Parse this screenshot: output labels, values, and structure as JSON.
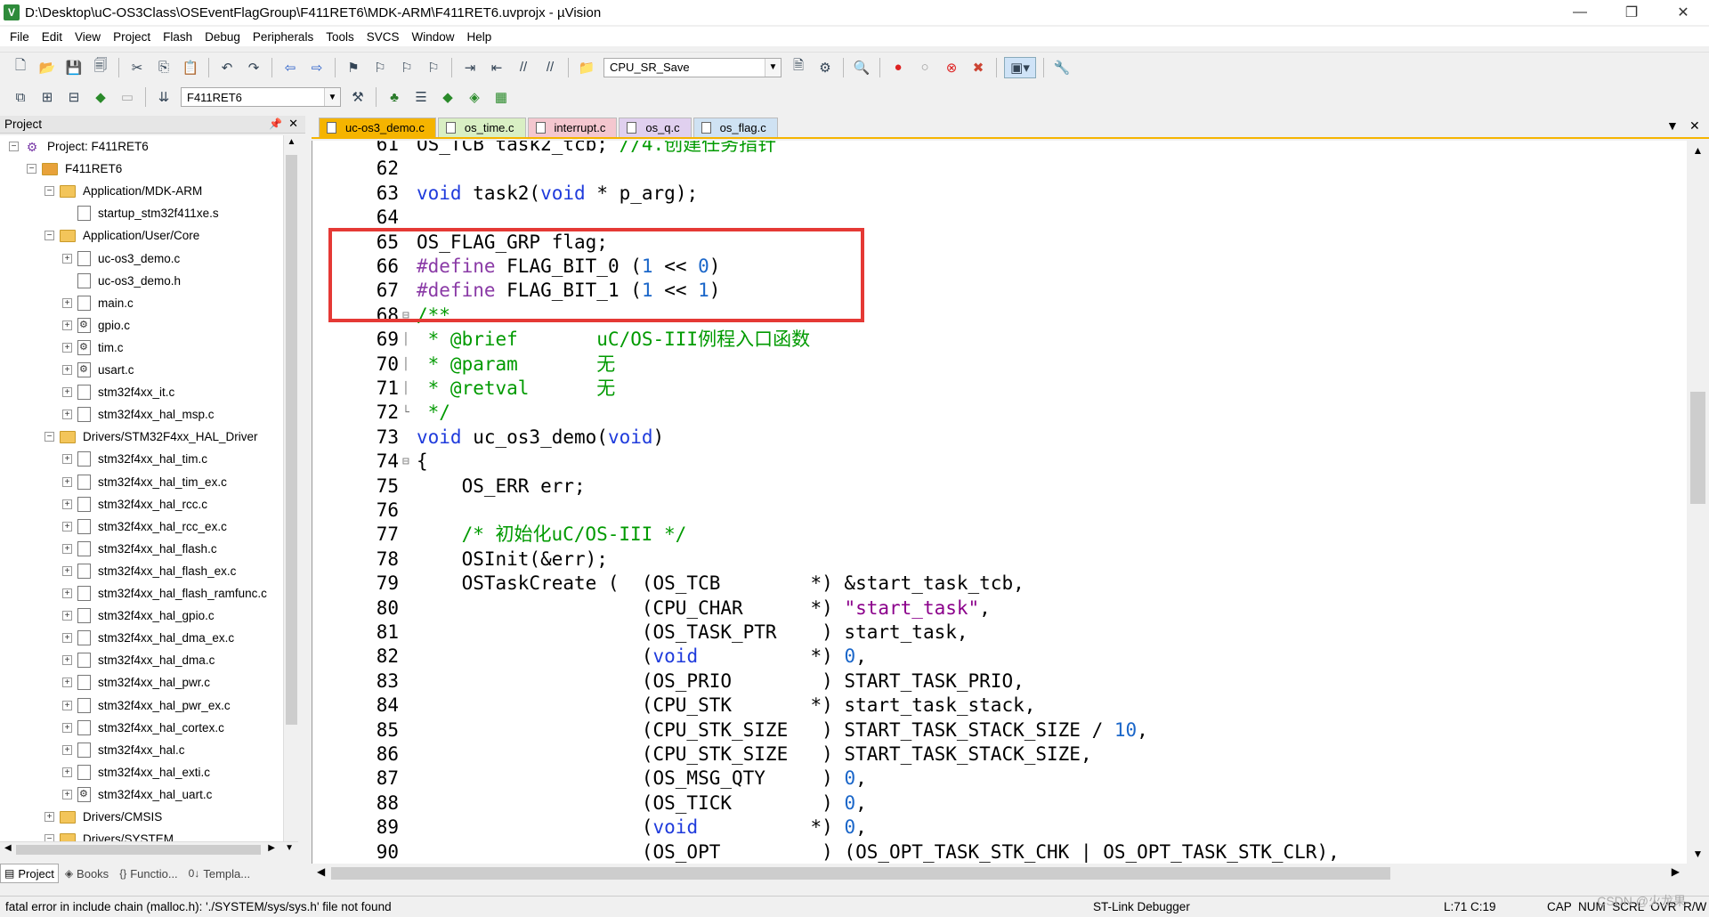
{
  "window": {
    "title": "D:\\Desktop\\uC-OS3Class\\OSEventFlagGroup\\F411RET6\\MDK-ARM\\F411RET6.uvprojx - µVision",
    "controls": {
      "minimize": "—",
      "restore": "❐",
      "close": "✕"
    }
  },
  "menu": [
    "File",
    "Edit",
    "View",
    "Project",
    "Flash",
    "Debug",
    "Peripherals",
    "Tools",
    "SVCS",
    "Window",
    "Help"
  ],
  "toolbar": {
    "find_combo": "CPU_SR_Save",
    "target_combo": "F411RET6"
  },
  "project_panel": {
    "title": "Project",
    "tree": [
      {
        "label": "Project: F411RET6",
        "level": 0,
        "kind": "project",
        "expander": "−"
      },
      {
        "label": "F411RET6",
        "level": 1,
        "kind": "target",
        "expander": "−"
      },
      {
        "label": "Application/MDK-ARM",
        "level": 2,
        "kind": "folder",
        "expander": "−"
      },
      {
        "label": "startup_stm32f411xe.s",
        "level": 3,
        "kind": "file",
        "expander": ""
      },
      {
        "label": "Application/User/Core",
        "level": 2,
        "kind": "folder",
        "expander": "−"
      },
      {
        "label": "uc-os3_demo.c",
        "level": 3,
        "kind": "file",
        "expander": "+"
      },
      {
        "label": "uc-os3_demo.h",
        "level": 3,
        "kind": "file",
        "expander": ""
      },
      {
        "label": "main.c",
        "level": 3,
        "kind": "file",
        "expander": "+"
      },
      {
        "label": "gpio.c",
        "level": 3,
        "kind": "keyfile",
        "expander": "+"
      },
      {
        "label": "tim.c",
        "level": 3,
        "kind": "keyfile",
        "expander": "+"
      },
      {
        "label": "usart.c",
        "level": 3,
        "kind": "keyfile",
        "expander": "+"
      },
      {
        "label": "stm32f4xx_it.c",
        "level": 3,
        "kind": "file",
        "expander": "+"
      },
      {
        "label": "stm32f4xx_hal_msp.c",
        "level": 3,
        "kind": "file",
        "expander": "+"
      },
      {
        "label": "Drivers/STM32F4xx_HAL_Driver",
        "level": 2,
        "kind": "folder",
        "expander": "−"
      },
      {
        "label": "stm32f4xx_hal_tim.c",
        "level": 3,
        "kind": "file",
        "expander": "+"
      },
      {
        "label": "stm32f4xx_hal_tim_ex.c",
        "level": 3,
        "kind": "file",
        "expander": "+"
      },
      {
        "label": "stm32f4xx_hal_rcc.c",
        "level": 3,
        "kind": "file",
        "expander": "+"
      },
      {
        "label": "stm32f4xx_hal_rcc_ex.c",
        "level": 3,
        "kind": "file",
        "expander": "+"
      },
      {
        "label": "stm32f4xx_hal_flash.c",
        "level": 3,
        "kind": "file",
        "expander": "+"
      },
      {
        "label": "stm32f4xx_hal_flash_ex.c",
        "level": 3,
        "kind": "file",
        "expander": "+"
      },
      {
        "label": "stm32f4xx_hal_flash_ramfunc.c",
        "level": 3,
        "kind": "file",
        "expander": "+"
      },
      {
        "label": "stm32f4xx_hal_gpio.c",
        "level": 3,
        "kind": "file",
        "expander": "+"
      },
      {
        "label": "stm32f4xx_hal_dma_ex.c",
        "level": 3,
        "kind": "file",
        "expander": "+"
      },
      {
        "label": "stm32f4xx_hal_dma.c",
        "level": 3,
        "kind": "file",
        "expander": "+"
      },
      {
        "label": "stm32f4xx_hal_pwr.c",
        "level": 3,
        "kind": "file",
        "expander": "+"
      },
      {
        "label": "stm32f4xx_hal_pwr_ex.c",
        "level": 3,
        "kind": "file",
        "expander": "+"
      },
      {
        "label": "stm32f4xx_hal_cortex.c",
        "level": 3,
        "kind": "file",
        "expander": "+"
      },
      {
        "label": "stm32f4xx_hal.c",
        "level": 3,
        "kind": "file",
        "expander": "+"
      },
      {
        "label": "stm32f4xx_hal_exti.c",
        "level": 3,
        "kind": "file",
        "expander": "+"
      },
      {
        "label": "stm32f4xx_hal_uart.c",
        "level": 3,
        "kind": "keyfile",
        "expander": "+"
      },
      {
        "label": "Drivers/CMSIS",
        "level": 2,
        "kind": "folder",
        "expander": "+"
      },
      {
        "label": "Drivers/SYSTEM",
        "level": 2,
        "kind": "folder",
        "expander": "−"
      }
    ],
    "bottom_tabs": [
      {
        "label": "Project",
        "icon": "▤",
        "active": true
      },
      {
        "label": "Books",
        "icon": "◈",
        "active": false
      },
      {
        "label": "Functio...",
        "icon": "{}",
        "active": false
      },
      {
        "label": "Templa...",
        "icon": "0↓",
        "active": false
      }
    ]
  },
  "editor": {
    "tabs": [
      {
        "label": "uc-os3_demo.c",
        "active": true
      },
      {
        "label": "os_time.c",
        "active": false
      },
      {
        "label": "interrupt.c",
        "active": false
      },
      {
        "label": "os_q.c",
        "active": false
      },
      {
        "label": "os_flag.c",
        "active": false
      }
    ],
    "lines": [
      {
        "num": "61",
        "fold": "",
        "html": "OS_TCB task2_tcb; <span class='c'>//4.创建任务指针</span>"
      },
      {
        "num": "62",
        "fold": "",
        "html": ""
      },
      {
        "num": "63",
        "fold": "",
        "html": "<span class='k'>void</span> task2(<span class='k'>void</span> * p_arg);"
      },
      {
        "num": "64",
        "fold": "",
        "html": ""
      },
      {
        "num": "65",
        "fold": "",
        "html": "OS_FLAG_GRP flag;"
      },
      {
        "num": "66",
        "fold": "",
        "html": "<span class='pp'>#define</span> FLAG_BIT_0 (<span class='n'>1</span> &lt;&lt; <span class='n'>0</span>)"
      },
      {
        "num": "67",
        "fold": "",
        "html": "<span class='pp'>#define</span> FLAG_BIT_1 (<span class='n'>1</span> &lt;&lt; <span class='n'>1</span>)"
      },
      {
        "num": "68",
        "fold": "⊟",
        "html": "<span class='c'>/**</span>"
      },
      {
        "num": "69",
        "fold": "│",
        "html": "<span class='c'> * @brief       uC/OS-III例程入口函数</span>"
      },
      {
        "num": "70",
        "fold": "│",
        "html": "<span class='c'> * @param       无</span>"
      },
      {
        "num": "71",
        "fold": "│",
        "html": "<span class='c'> * @retval      无</span>"
      },
      {
        "num": "72",
        "fold": "└",
        "html": "<span class='c'> */</span>"
      },
      {
        "num": "73",
        "fold": "",
        "html": "<span class='k'>void</span> uc_os3_demo(<span class='k'>void</span>)"
      },
      {
        "num": "74",
        "fold": "⊟",
        "html": "{"
      },
      {
        "num": "75",
        "fold": "",
        "html": "    OS_ERR err;"
      },
      {
        "num": "76",
        "fold": "",
        "html": ""
      },
      {
        "num": "77",
        "fold": "",
        "html": "    <span class='c'>/* 初始化uC/OS-III */</span>"
      },
      {
        "num": "78",
        "fold": "",
        "html": "    OSInit(&amp;err);"
      },
      {
        "num": "79",
        "fold": "",
        "html": "    OSTaskCreate (  (OS_TCB        *) &amp;start_task_tcb,"
      },
      {
        "num": "80",
        "fold": "",
        "html": "                    (CPU_CHAR      *) <span class='s'>\"start_task\"</span>,"
      },
      {
        "num": "81",
        "fold": "",
        "html": "                    (OS_TASK_PTR    ) start_task,"
      },
      {
        "num": "82",
        "fold": "",
        "html": "                    (<span class='k'>void</span>          *) <span class='n'>0</span>,"
      },
      {
        "num": "83",
        "fold": "",
        "html": "                    (OS_PRIO        ) START_TASK_PRIO,"
      },
      {
        "num": "84",
        "fold": "",
        "html": "                    (CPU_STK       *) start_task_stack,"
      },
      {
        "num": "85",
        "fold": "",
        "html": "                    (CPU_STK_SIZE   ) START_TASK_STACK_SIZE / <span class='n'>10</span>,"
      },
      {
        "num": "86",
        "fold": "",
        "html": "                    (CPU_STK_SIZE   ) START_TASK_STACK_SIZE,"
      },
      {
        "num": "87",
        "fold": "",
        "html": "                    (OS_MSG_QTY     ) <span class='n'>0</span>,"
      },
      {
        "num": "88",
        "fold": "",
        "html": "                    (OS_TICK        ) <span class='n'>0</span>,"
      },
      {
        "num": "89",
        "fold": "",
        "html": "                    (<span class='k'>void</span>          *) <span class='n'>0</span>,"
      },
      {
        "num": "90",
        "fold": "",
        "html": "                    (OS_OPT         ) (OS_OPT_TASK_STK_CHK | OS_OPT_TASK_STK_CLR),"
      }
    ]
  },
  "status": {
    "message": "fatal error in include chain (malloc.h): './SYSTEM/sys/sys.h' file not found",
    "debugger": "ST-Link Debugger",
    "position": "L:71 C:19",
    "indicators": "CAP  NUM  SCRL  OVR  R/W"
  },
  "watermark": "CSDN @火龙果"
}
